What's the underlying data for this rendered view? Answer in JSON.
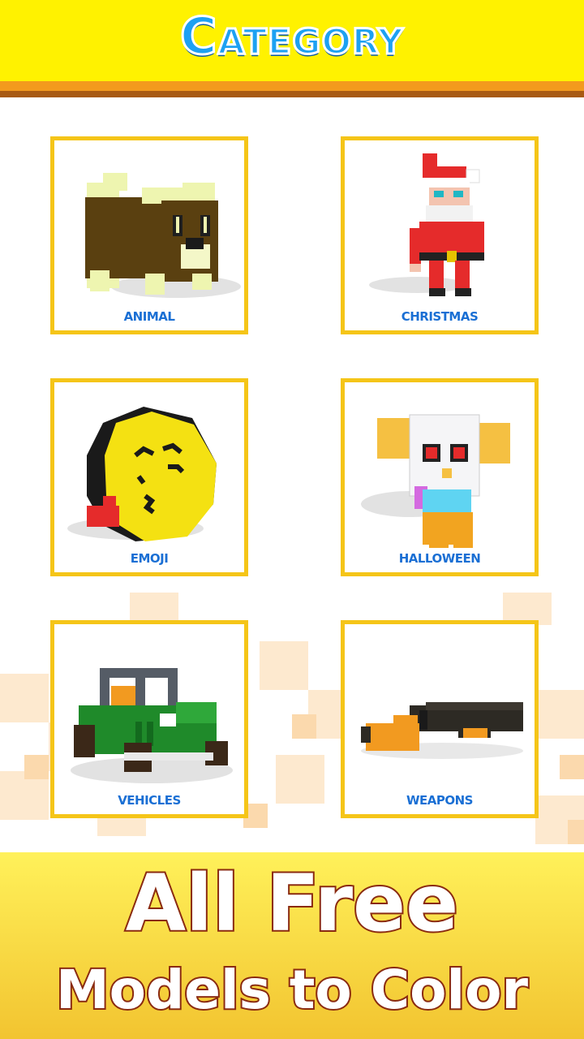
{
  "header": {
    "title": "Category"
  },
  "categories": [
    {
      "label": "ANIMAL",
      "icon": "voxel-bear-icon"
    },
    {
      "label": "CHRISTMAS",
      "icon": "voxel-santa-icon"
    },
    {
      "label": "EMOJI",
      "icon": "voxel-kiss-emoji-icon"
    },
    {
      "label": "HALLOWEEN",
      "icon": "voxel-owl-costume-icon"
    },
    {
      "label": "VEHICLES",
      "icon": "voxel-jeep-icon"
    },
    {
      "label": "WEAPONS",
      "icon": "voxel-shotgun-icon"
    }
  ],
  "promo": {
    "line1": "All Free",
    "line2": "Models to Color"
  },
  "colors": {
    "header_bg": "#fff200",
    "title": "#1da1f2",
    "card_border": "#f5c518",
    "label": "#1a6fd4",
    "promo_outline": "#8a2a10"
  }
}
